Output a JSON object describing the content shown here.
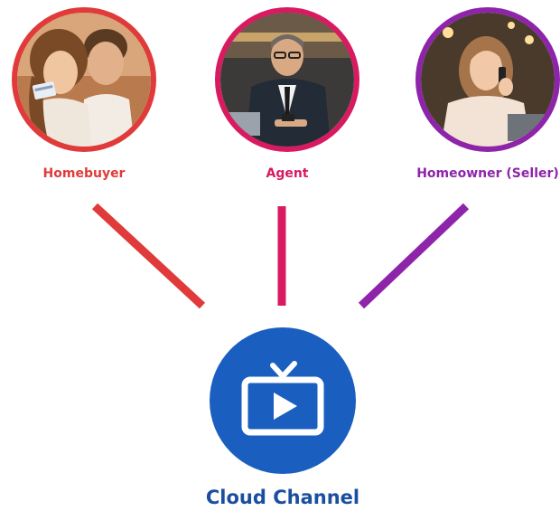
{
  "personas": [
    {
      "label": "Homebuyer",
      "color": "#e03a3a",
      "photo_icon": "couple-with-credit-card-photo"
    },
    {
      "label": "Agent",
      "color": "#d81b60",
      "photo_icon": "man-in-suit-with-phone-photo"
    },
    {
      "label": "Homeowner (Seller)",
      "color": "#8e24aa",
      "photo_icon": "woman-on-phone-photo"
    }
  ],
  "channel": {
    "label": "Cloud Channel",
    "color": "#1a5fbf",
    "label_color": "#1a4fa0",
    "icon": "tv-play-icon"
  }
}
